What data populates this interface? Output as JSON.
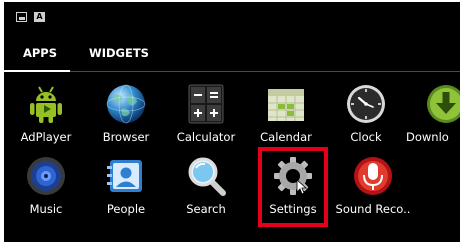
{
  "tabs": [
    {
      "label": "APPS",
      "selected": true
    },
    {
      "label": "WIDGETS",
      "selected": false
    }
  ],
  "apps": [
    {
      "label": "AdPlayer",
      "icon": "android-robot-icon"
    },
    {
      "label": "Browser",
      "icon": "globe-icon"
    },
    {
      "label": "Calculator",
      "icon": "calculator-icon"
    },
    {
      "label": "Calendar",
      "icon": "calendar-icon"
    },
    {
      "label": "Clock",
      "icon": "clock-icon"
    },
    {
      "label": "Downlo",
      "icon": "download-icon"
    },
    {
      "label": "Music",
      "icon": "speaker-icon"
    },
    {
      "label": "People",
      "icon": "contacts-icon"
    },
    {
      "label": "Search",
      "icon": "magnifier-icon"
    },
    {
      "label": "Settings",
      "icon": "gear-icon",
      "highlighted": true
    },
    {
      "label": "Sound Reco..",
      "icon": "microphone-icon"
    }
  ],
  "colors": {
    "background": "#000000",
    "text": "#ffffff",
    "highlight": "#e4001b",
    "android_green": "#97c024"
  }
}
